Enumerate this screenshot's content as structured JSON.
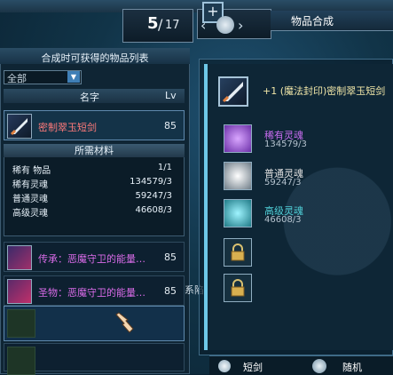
{
  "page_indicator": {
    "current": "5",
    "separator": "/",
    "total": "17"
  },
  "right_panel": {
    "title": "物品合成",
    "target": {
      "name": "+1 (魔法封印)密制翠玉短剑"
    },
    "materials": [
      {
        "name": "稀有灵魂",
        "count": "134579/3",
        "color": "#c86cf0"
      },
      {
        "name": "普通灵魂",
        "count": "59247/3",
        "color": "#e0e0e0"
      },
      {
        "name": "高级灵魂",
        "count": "46608/3",
        "color": "#4fd0d8"
      }
    ],
    "tabs": [
      "短剑",
      "随机"
    ]
  },
  "left_panel": {
    "title": "合成时可获得的物品列表",
    "filter": {
      "selected": "全部"
    },
    "columns": {
      "name": "名字",
      "lv": "Lv"
    },
    "selected_item": {
      "name": "密制翠玉短剑",
      "lv": "85"
    },
    "required_header": "所需材料",
    "required": [
      {
        "name": "稀有 物品",
        "count": "1/1"
      },
      {
        "name": "稀有灵魂",
        "count": "134579/3"
      },
      {
        "name": "普通灵魂",
        "count": "59247/3"
      },
      {
        "name": "高级灵魂",
        "count": "46608/3"
      }
    ],
    "items": [
      {
        "name": "传承：恶魔守卫的能量…",
        "lv": "85"
      },
      {
        "name": "圣物：恶魔守卫的能量…",
        "lv": "85"
      }
    ]
  },
  "stray_text": "系陷",
  "colors": {
    "accent": "#6ec8e8",
    "rare_red": "#ff7a7a",
    "epic_purple": "#d96be8"
  }
}
